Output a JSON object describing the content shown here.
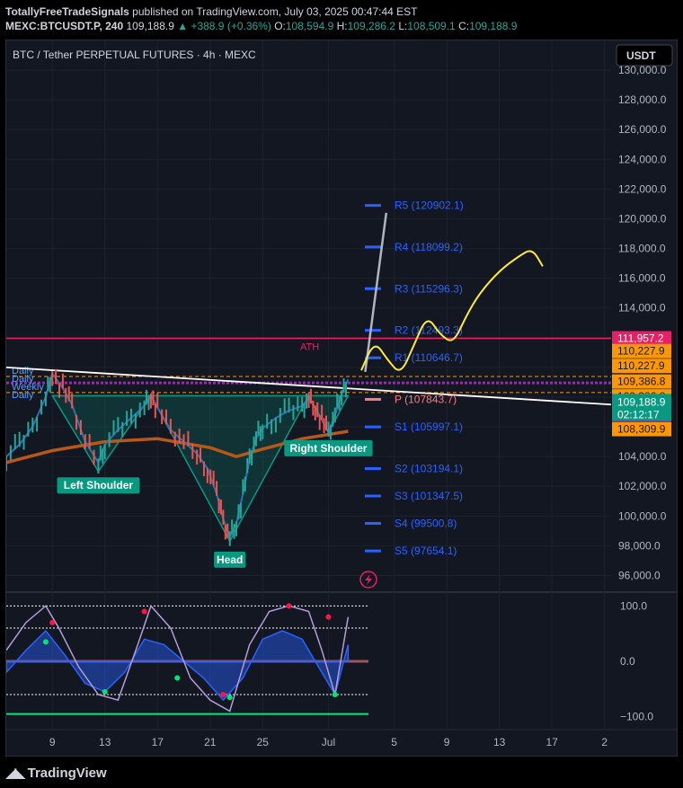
{
  "header": {
    "publisher": "TotallyFreeTradeSignals",
    "published_text": "published on TradingView.com, July 03, 2025 00:47:44 EST",
    "symbol": "MEXC:BTCUSDT.P, 240",
    "last": "109,188.9",
    "change": "▲ +388.9 (+0.36%)",
    "o_label": "O:",
    "o": "108,594.9",
    "h_label": "H:",
    "h": "109,286.2",
    "l_label": "L:",
    "l": "108,509.1",
    "c_label": "C:",
    "c": "109,188.9"
  },
  "chart_title": "BTC / Tether PERPETUAL FUTURES · 4h · MEXC",
  "currency_button": "USDT",
  "colors": {
    "background": "#131722",
    "up": "#26a69a",
    "down": "#ef5350",
    "ath": "#e91e63",
    "pivot_blue": "#2962ff",
    "pivot_red": "#f77c80",
    "annotation": "#ffeb3b",
    "label_green": "#089981"
  },
  "chart_data": {
    "type": "line",
    "price_axis": {
      "ylim": [
        95000,
        132000
      ],
      "ticks": [
        96000,
        98000,
        100000,
        102000,
        104000,
        106000,
        108000,
        110000,
        112000,
        114000,
        116000,
        118000,
        120000,
        122000,
        124000,
        126000,
        128000,
        130000
      ],
      "tick_labels": [
        "96,000.0",
        "98,000.0",
        "100,000.0",
        "102,000.0",
        "104,000.0",
        "106,000.0",
        "108,000.0",
        "110,000.0",
        "112,000.0",
        "114,000.0",
        "116,000.0",
        "118,000.0",
        "120,000.0",
        "122,000.0",
        "124,000.0",
        "126,000.0",
        "128,000.0",
        "130,000.0"
      ]
    },
    "x_axis": {
      "ticks": [
        9,
        13,
        17,
        21,
        25,
        30,
        35,
        39,
        43,
        47,
        51
      ],
      "tick_labels": [
        "9",
        "13",
        "17",
        "21",
        "25",
        "Jul",
        "5",
        "9",
        "13",
        "17",
        "2"
      ],
      "xlim": [
        5.5,
        51.5
      ]
    },
    "price_series": [
      {
        "x": 5.5,
        "y": 104000
      },
      {
        "x": 6.5,
        "y": 104800
      },
      {
        "x": 7.5,
        "y": 106000
      },
      {
        "x": 8.5,
        "y": 108000
      },
      {
        "x": 9,
        "y": 109600
      },
      {
        "x": 9.8,
        "y": 108600
      },
      {
        "x": 10.5,
        "y": 107500
      },
      {
        "x": 11.5,
        "y": 105000
      },
      {
        "x": 12.5,
        "y": 103600
      },
      {
        "x": 13,
        "y": 104800
      },
      {
        "x": 14,
        "y": 105800
      },
      {
        "x": 15,
        "y": 106600
      },
      {
        "x": 16,
        "y": 107400
      },
      {
        "x": 16.5,
        "y": 108100
      },
      {
        "x": 17,
        "y": 107300
      },
      {
        "x": 18,
        "y": 105800
      },
      {
        "x": 19,
        "y": 105000
      },
      {
        "x": 20,
        "y": 104200
      },
      {
        "x": 20.8,
        "y": 103200
      },
      {
        "x": 21.5,
        "y": 101500
      },
      {
        "x": 22,
        "y": 99800
      },
      {
        "x": 22.5,
        "y": 98600
      },
      {
        "x": 23,
        "y": 99500
      },
      {
        "x": 23.5,
        "y": 101500
      },
      {
        "x": 24,
        "y": 103800
      },
      {
        "x": 24.5,
        "y": 105200
      },
      {
        "x": 25,
        "y": 105900
      },
      {
        "x": 26,
        "y": 106600
      },
      {
        "x": 27,
        "y": 107100
      },
      {
        "x": 28,
        "y": 107400
      },
      {
        "x": 28.5,
        "y": 107900
      },
      {
        "x": 29,
        "y": 107300
      },
      {
        "x": 29.5,
        "y": 106500
      },
      {
        "x": 30,
        "y": 105600
      },
      {
        "x": 30.5,
        "y": 106800
      },
      {
        "x": 31,
        "y": 108200
      },
      {
        "x": 31.5,
        "y": 109189
      }
    ],
    "ma_series": [
      {
        "x": 5.5,
        "y": 103600
      },
      {
        "x": 9,
        "y": 104400
      },
      {
        "x": 13,
        "y": 105000
      },
      {
        "x": 17,
        "y": 105200
      },
      {
        "x": 21,
        "y": 104600
      },
      {
        "x": 23,
        "y": 104000
      },
      {
        "x": 25,
        "y": 104500
      },
      {
        "x": 28,
        "y": 105200
      },
      {
        "x": 31.5,
        "y": 105700
      }
    ],
    "pattern_lines": [
      [
        {
          "x": 9,
          "y": 108100
        },
        {
          "x": 12.5,
          "y": 103000
        },
        {
          "x": 16.5,
          "y": 108100
        }
      ],
      [
        {
          "x": 16.5,
          "y": 108100
        },
        {
          "x": 22.5,
          "y": 98300
        },
        {
          "x": 28.5,
          "y": 108100
        }
      ],
      [
        {
          "x": 28.5,
          "y": 108100
        },
        {
          "x": 30,
          "y": 105600
        },
        {
          "x": 31.5,
          "y": 108100
        }
      ]
    ],
    "trendline": [
      {
        "x": 5.5,
        "y": 110000
      },
      {
        "x": 51.5,
        "y": 107500
      }
    ],
    "ath_line": {
      "y": 111957.2,
      "label": "ATH"
    },
    "dashed_levels": [
      109386.8,
      108309.9
    ],
    "pivot_levels": [
      {
        "label": "R5 (120902.1)",
        "y": 120902.1
      },
      {
        "label": "R4 (118099.2)",
        "y": 118099.2
      },
      {
        "label": "R3 (115296.3)",
        "y": 115296.3
      },
      {
        "label": "R2 (112493.3)",
        "y": 112493.3
      },
      {
        "label": "R1 (110646.7)",
        "y": 110646.7
      },
      {
        "label": "P (107843.7)",
        "y": 107843.7
      },
      {
        "label": "S1 (105997.1)",
        "y": 105997.1
      },
      {
        "label": "S2 (103194.1)",
        "y": 103194.1
      },
      {
        "label": "S3 (101347.5)",
        "y": 101347.5
      },
      {
        "label": "S4 (99500.8)",
        "y": 99500.8
      },
      {
        "label": "S5 (97654.1)",
        "y": 97654.1
      }
    ],
    "daily_weekly_labels": [
      "Daily",
      "Daily",
      "Weekly",
      "Daily"
    ],
    "pattern_labels": [
      {
        "text": "Left Shoulder",
        "x": 12.5,
        "y": 102000
      },
      {
        "text": "Head",
        "x": 22.5,
        "y": 97000
      },
      {
        "text": "Right Shoulder",
        "x": 30,
        "y": 104500
      }
    ],
    "projection_path": [
      {
        "x": 32.5,
        "y": 109800
      },
      {
        "x": 33.5,
        "y": 111800
      },
      {
        "x": 34.5,
        "y": 110500
      },
      {
        "x": 35.5,
        "y": 109500
      },
      {
        "x": 36.5,
        "y": 111500
      },
      {
        "x": 37.5,
        "y": 113500
      },
      {
        "x": 38.5,
        "y": 112200
      },
      {
        "x": 39.5,
        "y": 111600
      },
      {
        "x": 40.5,
        "y": 113500
      },
      {
        "x": 41.5,
        "y": 115000
      },
      {
        "x": 43,
        "y": 116500
      },
      {
        "x": 44.5,
        "y": 117500
      },
      {
        "x": 45.5,
        "y": 118000
      },
      {
        "x": 46.3,
        "y": 116800
      }
    ],
    "gray_arrow": [
      {
        "x": 32.8,
        "y": 109700
      },
      {
        "x": 34.4,
        "y": 120400
      }
    ],
    "price_badges": [
      {
        "text": "111,957.2",
        "y": 111957.2,
        "bg": "#e91e63",
        "fg": "#ffffff"
      },
      {
        "text": "110,227.9",
        "y": 111100,
        "bg": "#ff9800",
        "fg": "#131722"
      },
      {
        "text": "110,227.9",
        "y": 110100,
        "bg": "#ff9800",
        "fg": "#131722"
      },
      {
        "text": "109,386.8",
        "y": 109050,
        "bg": "#ff9800",
        "fg": "#131722"
      },
      {
        "text": "109,386.8",
        "y": 108050,
        "bg": "#ff9800",
        "fg": "#131722"
      },
      {
        "text": "108,955.9",
        "y": 106850,
        "bg": "#9c27b0",
        "fg": "#ffffff"
      },
      {
        "text": "108,309.9",
        "y": 105850,
        "bg": "#ff9800",
        "fg": "#131722"
      }
    ],
    "last_price_badge": {
      "text": "109,188.9",
      "countdown": "02:12:17",
      "y": 107250
    },
    "oscillator": {
      "ylim": [
        -120,
        120
      ],
      "ticks": [
        100,
        0,
        -100
      ],
      "tick_labels": [
        "100.0",
        "0.0",
        "−100.0"
      ],
      "wave_a": [
        {
          "x": 5.5,
          "y": -20
        },
        {
          "x": 7,
          "y": 20
        },
        {
          "x": 8.5,
          "y": 55
        },
        {
          "x": 10,
          "y": 10
        },
        {
          "x": 11.5,
          "y": -40
        },
        {
          "x": 13,
          "y": -55
        },
        {
          "x": 14.5,
          "y": -20
        },
        {
          "x": 16,
          "y": 40
        },
        {
          "x": 17.5,
          "y": 30
        },
        {
          "x": 19,
          "y": 0
        },
        {
          "x": 20.5,
          "y": -30
        },
        {
          "x": 22,
          "y": -70
        },
        {
          "x": 23.5,
          "y": -30
        },
        {
          "x": 25,
          "y": 40
        },
        {
          "x": 26.5,
          "y": 55
        },
        {
          "x": 28,
          "y": 40
        },
        {
          "x": 29.5,
          "y": -20
        },
        {
          "x": 30.5,
          "y": -60
        },
        {
          "x": 31.5,
          "y": 30
        }
      ],
      "wave_b": [
        {
          "x": 5.5,
          "y": 20
        },
        {
          "x": 7,
          "y": 70
        },
        {
          "x": 8.5,
          "y": 100
        },
        {
          "x": 9.5,
          "y": 60
        },
        {
          "x": 11,
          "y": -10
        },
        {
          "x": 12.5,
          "y": -60
        },
        {
          "x": 14,
          "y": -70
        },
        {
          "x": 15.5,
          "y": 30
        },
        {
          "x": 16.5,
          "y": 100
        },
        {
          "x": 18,
          "y": 60
        },
        {
          "x": 19.5,
          "y": -30
        },
        {
          "x": 21,
          "y": -70
        },
        {
          "x": 22.5,
          "y": -90
        },
        {
          "x": 24,
          "y": 30
        },
        {
          "x": 25.5,
          "y": 90
        },
        {
          "x": 27,
          "y": 100
        },
        {
          "x": 28.5,
          "y": 90
        },
        {
          "x": 29.5,
          "y": 20
        },
        {
          "x": 30.5,
          "y": -60
        },
        {
          "x": 31.5,
          "y": 80
        }
      ]
    }
  }
}
